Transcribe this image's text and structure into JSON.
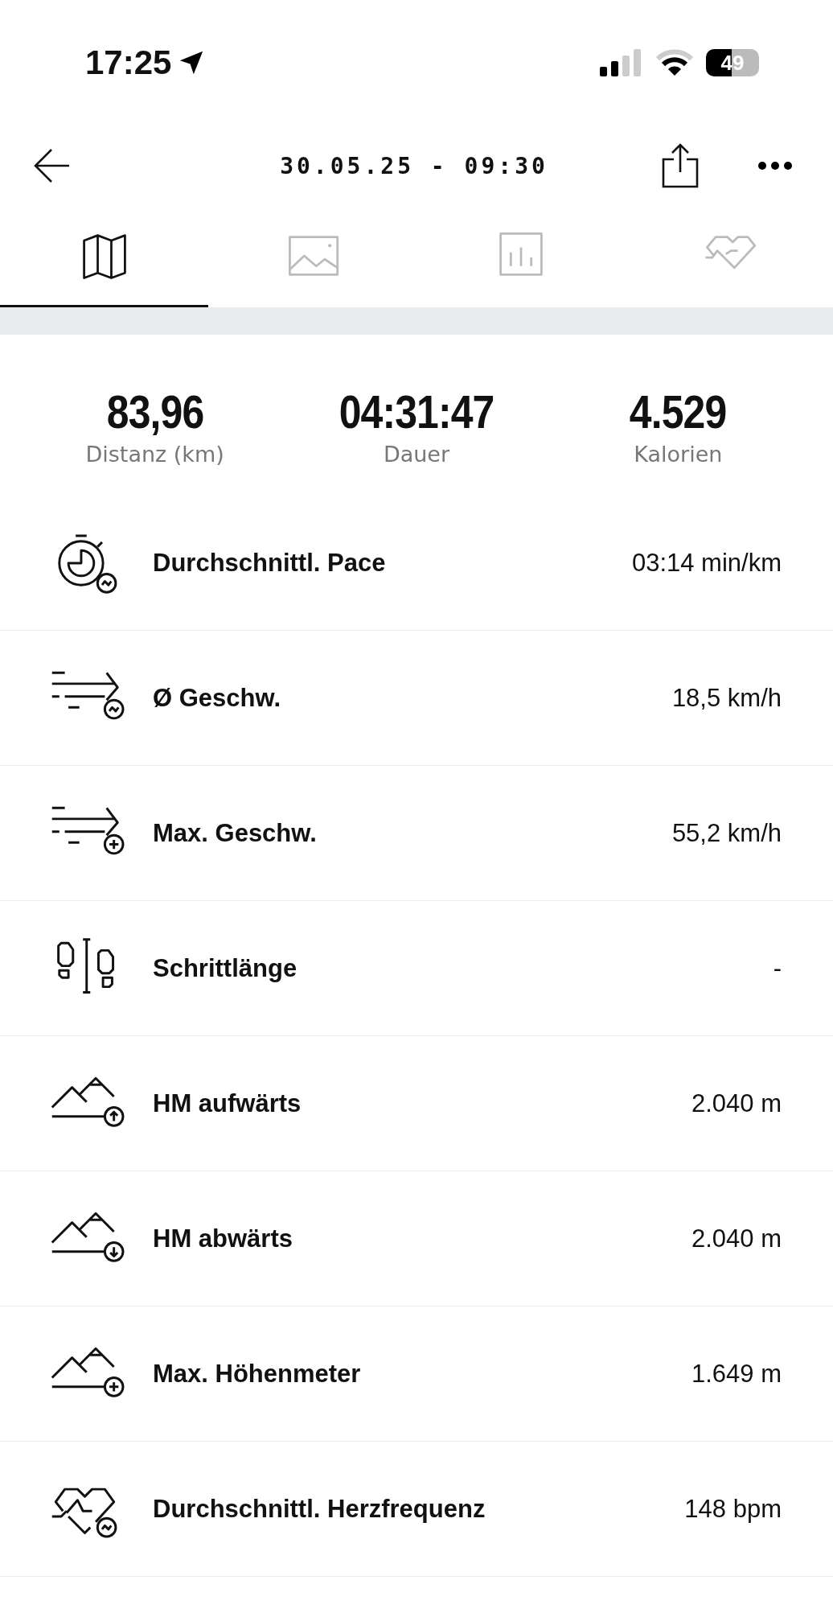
{
  "status_bar": {
    "time": "17:25",
    "battery": "49"
  },
  "header": {
    "title": "30.05.25 - 09:30"
  },
  "tabs": [
    {
      "kind": "map",
      "selected": true
    },
    {
      "kind": "photo",
      "selected": false
    },
    {
      "kind": "chart",
      "selected": false
    },
    {
      "kind": "heart",
      "selected": false
    }
  ],
  "summary": [
    {
      "value": "83,96",
      "label": "Distanz (km)"
    },
    {
      "value": "04:31:47",
      "label": "Dauer"
    },
    {
      "value": "4.529",
      "label": "Kalorien"
    }
  ],
  "metrics": [
    {
      "kind": "pace",
      "label": "Durchschnittl. Pace",
      "value": "03:14 min/km"
    },
    {
      "kind": "avg-speed",
      "label": "Ø Geschw.",
      "value": "18,5 km/h"
    },
    {
      "kind": "max-speed",
      "label": "Max. Geschw.",
      "value": "55,2 km/h"
    },
    {
      "kind": "stride",
      "label": "Schrittlänge",
      "value": "-"
    },
    {
      "kind": "ascent",
      "label": "HM aufwärts",
      "value": "2.040 m"
    },
    {
      "kind": "descent",
      "label": "HM abwärts",
      "value": "2.040 m"
    },
    {
      "kind": "max-altitude",
      "label": "Max. Höhenmeter",
      "value": "1.649 m"
    },
    {
      "kind": "heart-rate",
      "label": "Durchschnittl. Herzfrequenz",
      "value": "148 bpm"
    }
  ]
}
